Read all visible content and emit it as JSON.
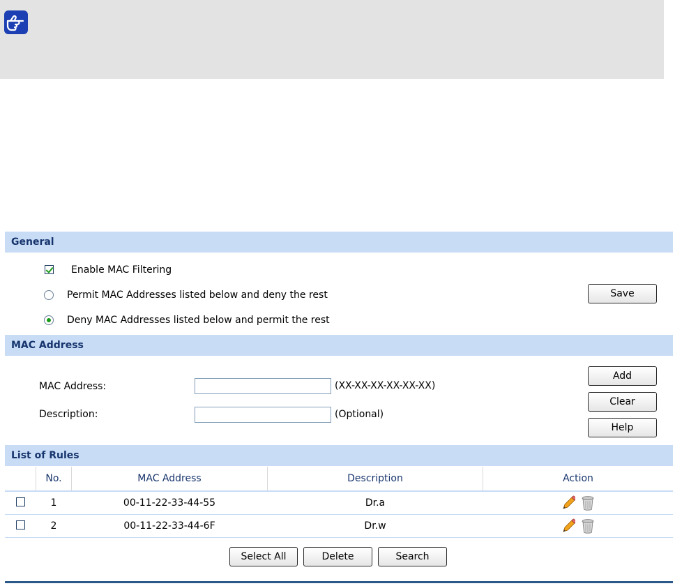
{
  "note": {
    "icon": "pointing-hand-note-icon"
  },
  "general": {
    "header": "General",
    "enable_label": "Enable MAC Filtering",
    "enable_checked": true,
    "permit_label": "Permit MAC Addresses listed below and deny the rest",
    "deny_label": "Deny MAC Addresses listed below and permit the rest",
    "selected_mode": "deny",
    "save_label": "Save"
  },
  "mac_address": {
    "header": "MAC Address",
    "mac_label": "MAC Address:",
    "mac_value": "",
    "mac_hint": "(XX-XX-XX-XX-XX-XX)",
    "desc_label": "Description:",
    "desc_value": "",
    "desc_hint": "(Optional)",
    "add_label": "Add",
    "clear_label": "Clear",
    "help_label": "Help"
  },
  "rules": {
    "header": "List of Rules",
    "columns": [
      "",
      "No.",
      "MAC Address",
      "Description",
      "Action"
    ],
    "rows": [
      {
        "no": "1",
        "mac": "00-11-22-33-44-55",
        "desc": "Dr.a"
      },
      {
        "no": "2",
        "mac": "00-11-22-33-44-6F",
        "desc": "Dr.w"
      }
    ],
    "select_all_label": "Select All",
    "delete_label": "Delete",
    "search_label": "Search"
  },
  "colors": {
    "section_header_bg": "#c8dcf6",
    "section_header_text": "#17356d",
    "accent_green": "#1a9a1a",
    "note_bg": "#e3e3e3",
    "bottom_rule": "#2b5a8a"
  }
}
